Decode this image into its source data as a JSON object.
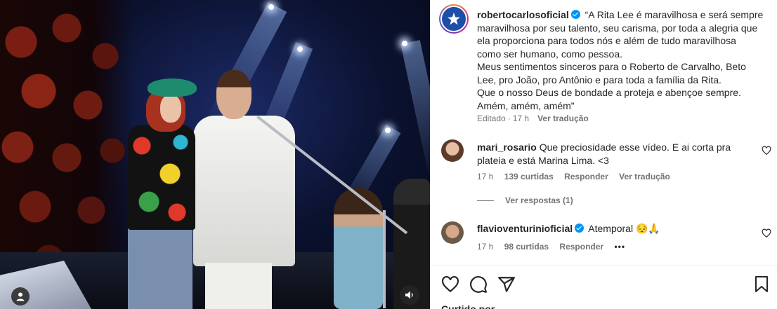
{
  "post": {
    "username": "robertocarlosoficial",
    "caption_lines": [
      "“A Rita Lee é maravilhosa e será sempre",
      "maravilhosa por seu talento, seu carisma, por toda a alegria que",
      "ela proporciona para todos nós e além de tudo maravilhosa",
      "como ser humano, como pessoa.",
      "Meus sentimentos sinceros para o Roberto de Carvalho, Beto",
      "Lee, pro João, pro Antônio e para toda a família da Rita.",
      "Que o nosso Deus de bondade a proteja e abençoe sempre.",
      "Amém, amém, amém”"
    ],
    "edited_label": "Editado",
    "time": "17 h",
    "translate_label": "Ver tradução"
  },
  "comments": [
    {
      "username": "mari_rosario",
      "text": "Que preciosidade esse vídeo. E ai corta pra plateia e está Marina Lima. <3",
      "time": "17 h",
      "likes": "139 curtidas",
      "reply_label": "Responder",
      "translate_label": "Ver tradução",
      "view_replies": "Ver respostas (1)"
    },
    {
      "username": "flavioventurinioficial",
      "text": "Atemporal 😔🙏",
      "time": "17 h",
      "likes": "98 curtidas",
      "reply_label": "Responder",
      "more": "•••"
    }
  ],
  "actions": {
    "icons": [
      "heart-icon",
      "comment-icon",
      "share-icon",
      "bookmark-icon"
    ]
  },
  "likes_peek": "Curtido por ...",
  "colors": {
    "verified": "#0095f6",
    "muted_text": "#737373",
    "text": "#262626"
  }
}
